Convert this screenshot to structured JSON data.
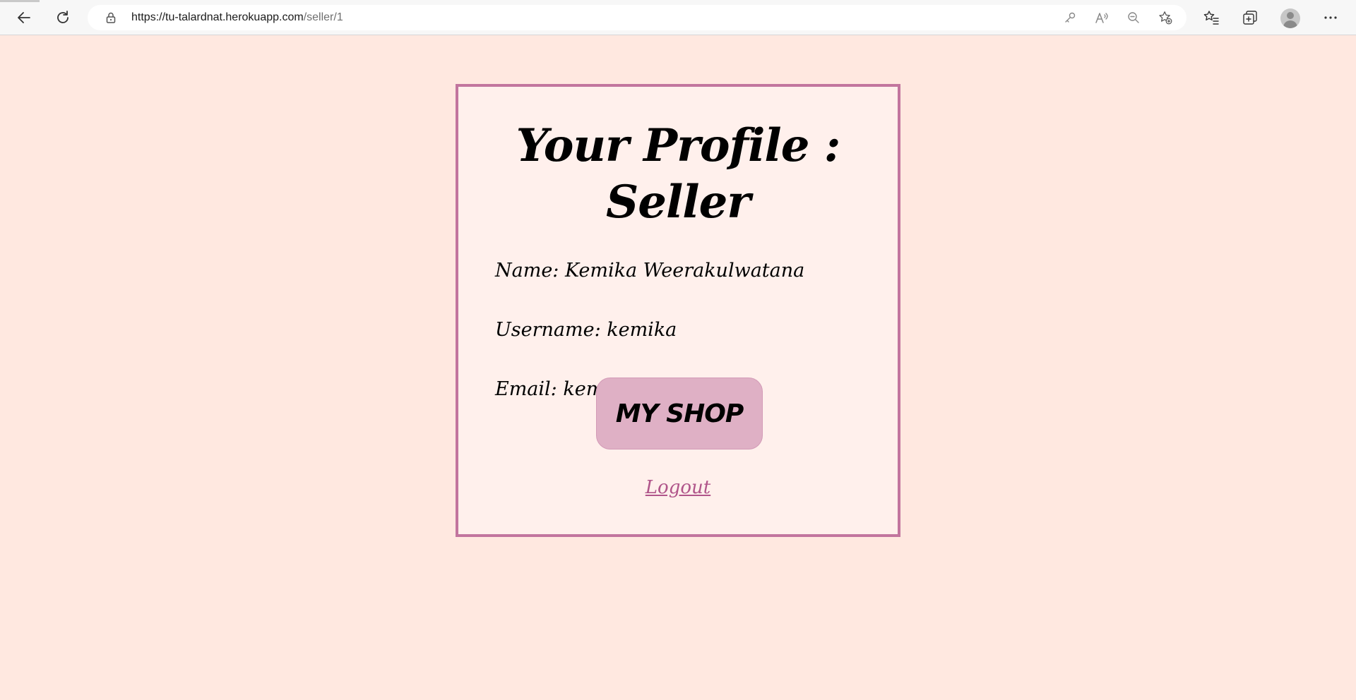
{
  "browser": {
    "url_host": "https://tu-talardnat.herokuapp.com",
    "url_path": "/seller/1",
    "icons": {
      "back": "back-arrow-icon",
      "refresh": "refresh-icon",
      "lock": "lock-icon",
      "key": "key-icon",
      "read_aloud": "read-aloud-icon",
      "zoom": "zoom-out-icon",
      "add_favorite": "add-favorite-icon",
      "favorites": "favorites-icon",
      "collections": "collections-icon",
      "profile": "profile-avatar-icon",
      "more": "more-options-icon"
    }
  },
  "profile": {
    "title": "Your Profile : Seller",
    "name_line": "Name: Kemika Weerakulwatana",
    "username_line": "Username: kemika",
    "email_line": "Email: kemika@kem.com",
    "shop_button": "MY SHOP",
    "logout_link": "Logout"
  },
  "colors": {
    "page_background": "#ffe8e0",
    "card_background": "#fff0ec",
    "card_border": "#c2759e",
    "button_background": "#dfb0c5",
    "link_color": "#b0558a"
  }
}
